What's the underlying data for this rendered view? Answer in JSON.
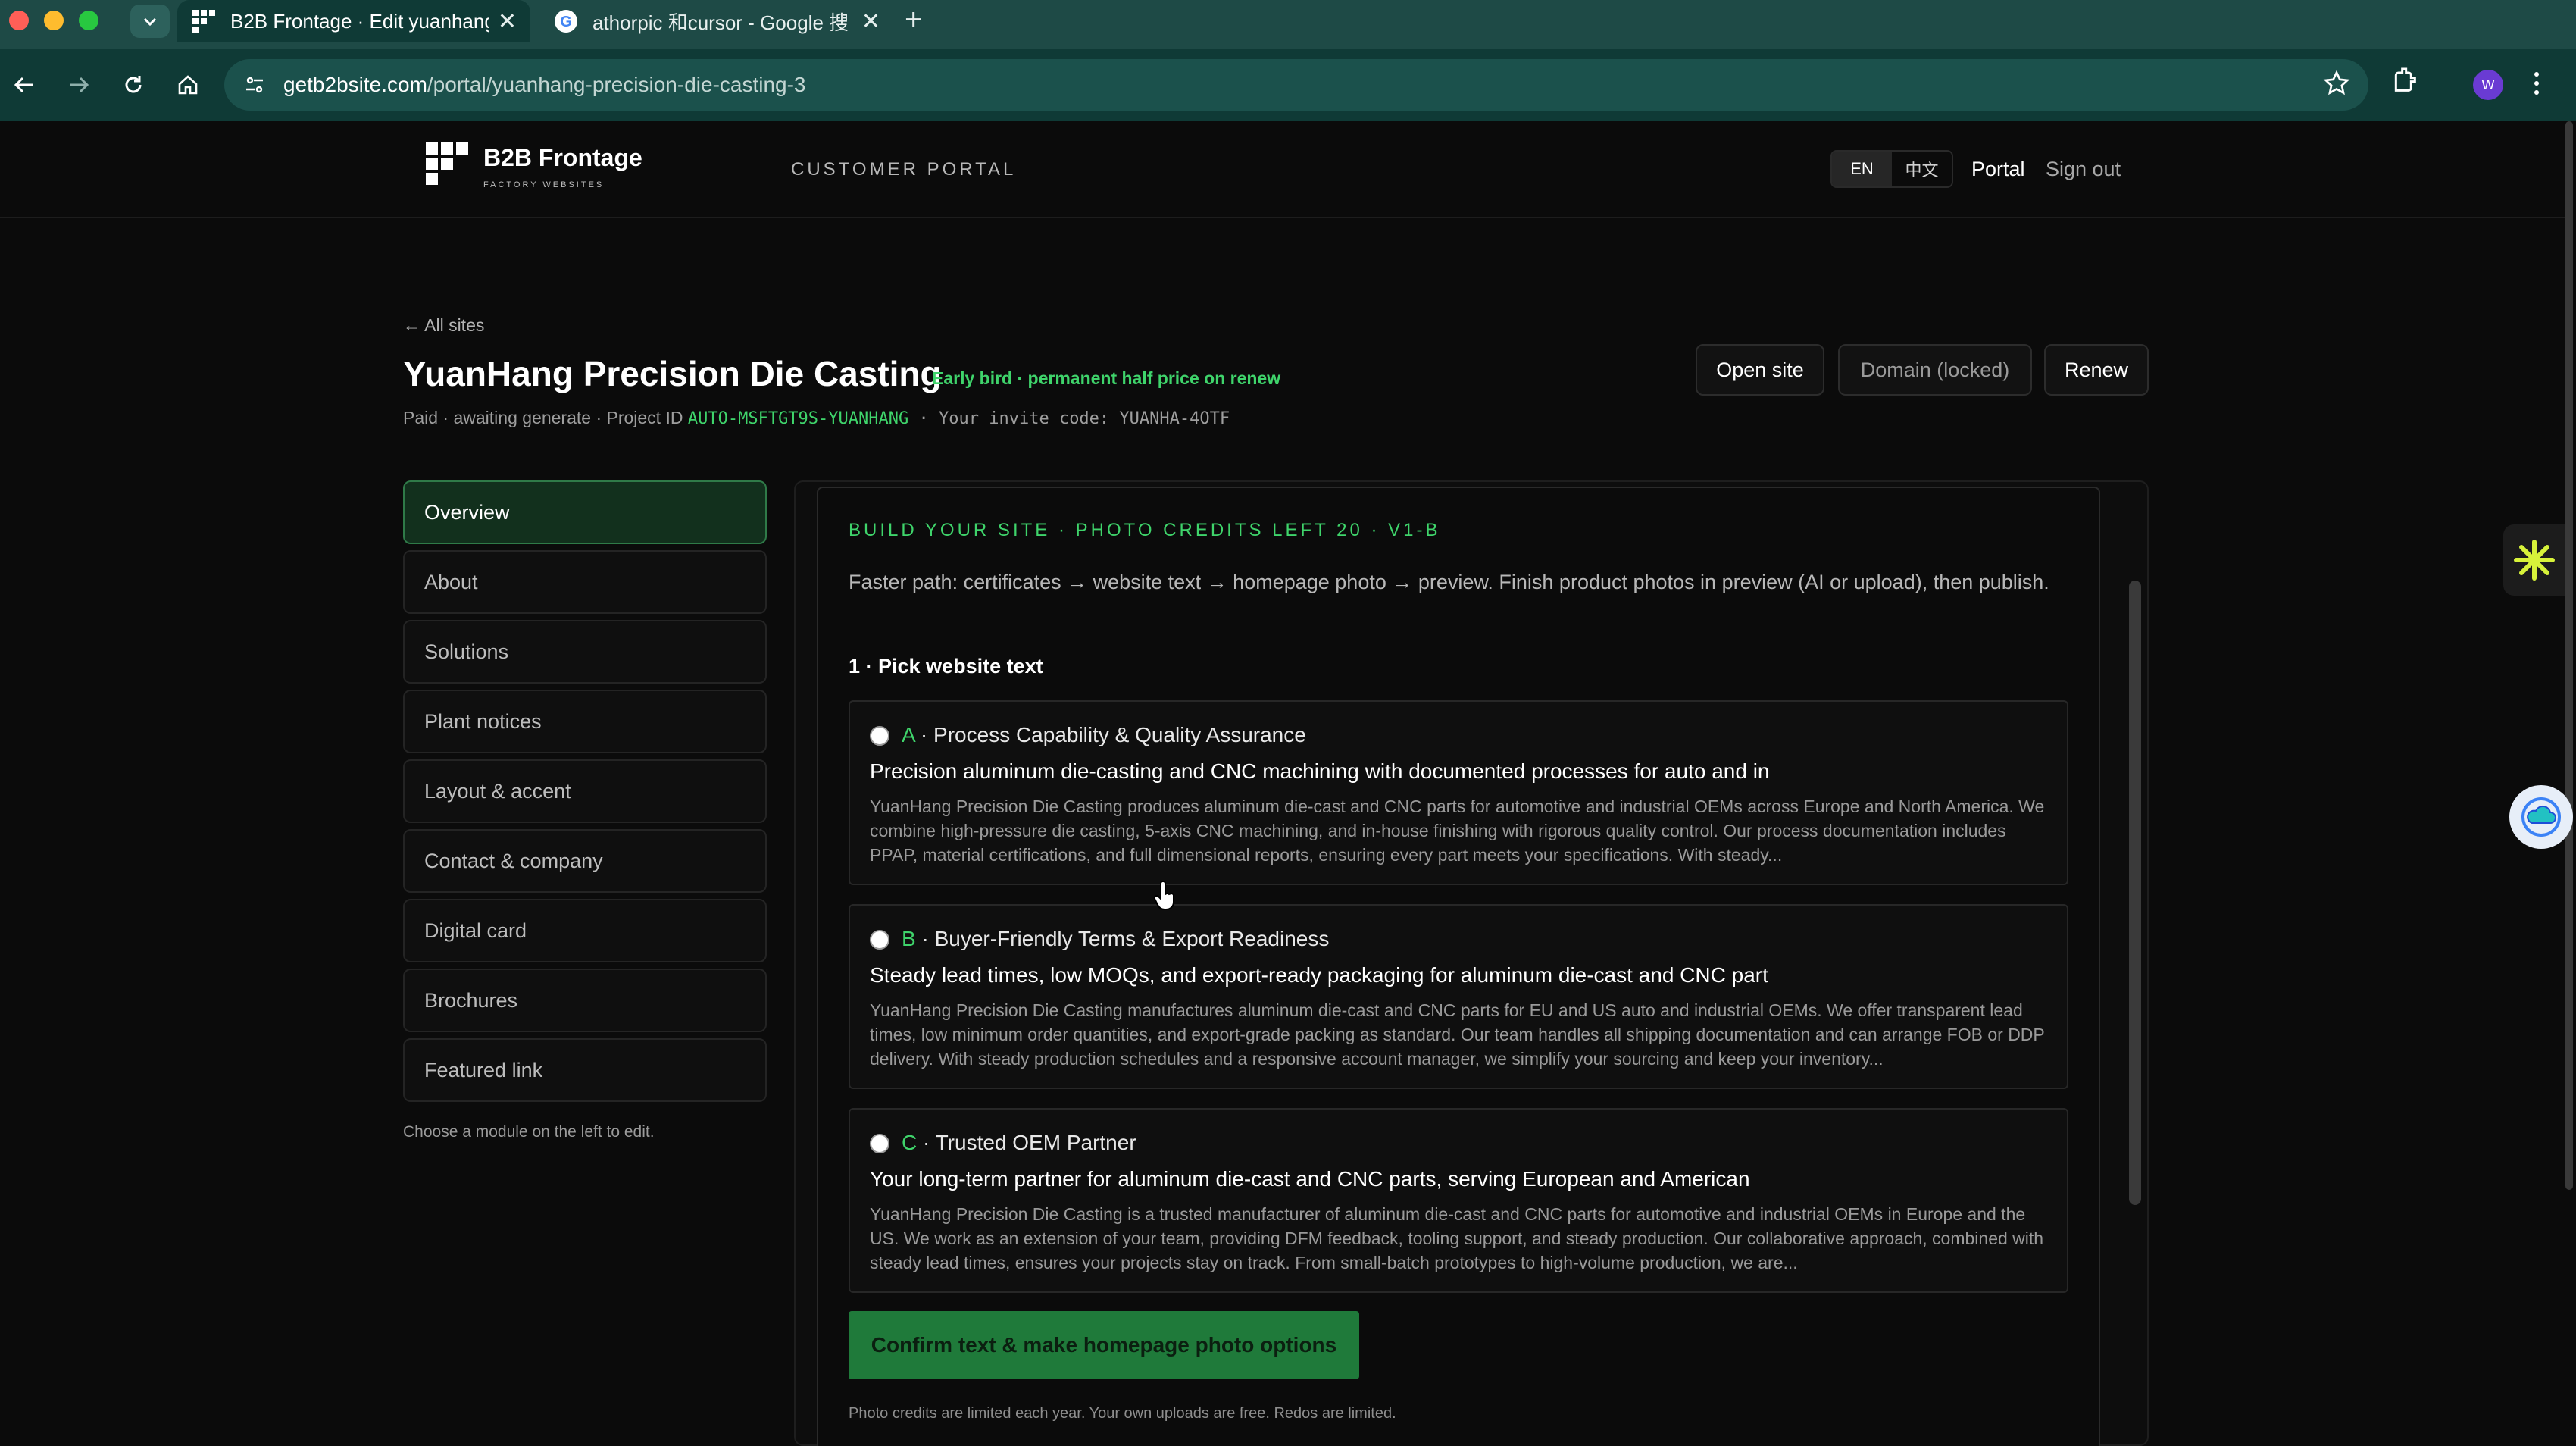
{
  "browser": {
    "tabs": [
      {
        "title": "B2B Frontage · Edit yuanhang"
      },
      {
        "title": "athorpic 和cursor - Google 搜"
      }
    ],
    "url_host": "getb2bsite.com",
    "url_path": "/portal/yuanhang-precision-die-casting-3",
    "profile_initial": "W"
  },
  "header": {
    "brand": "B2B Frontage",
    "brand_sub": "FACTORY WEBSITES",
    "portal_label": "CUSTOMER PORTAL",
    "lang_en": "EN",
    "lang_zh": "中文",
    "nav_portal": "Portal",
    "nav_signout": "Sign out"
  },
  "site": {
    "back": "← All sites",
    "title": "YuanHang Precision Die Casting",
    "early_bird": "Early bird · permanent half price on renew",
    "status": "Paid · awaiting generate · Project ID ",
    "project_id": "AUTO-MSFTGT9S-YUANHANG",
    "invite_label": " · Your invite code: ",
    "invite_code": "YUANHA-4OTF",
    "actions": {
      "open": "Open site",
      "domain": "Domain (locked)",
      "renew": "Renew"
    }
  },
  "sidebar": {
    "items": [
      {
        "label": "Overview"
      },
      {
        "label": "About"
      },
      {
        "label": "Solutions"
      },
      {
        "label": "Plant notices"
      },
      {
        "label": "Layout & accent"
      },
      {
        "label": "Contact & company"
      },
      {
        "label": "Digital card"
      },
      {
        "label": "Brochures"
      },
      {
        "label": "Featured link"
      }
    ],
    "hint": "Choose a module on the left to edit."
  },
  "builder": {
    "title": "BUILD YOUR SITE · PHOTO CREDITS LEFT 20 · V1-B",
    "description": "Faster path: certificates → website text → homepage photo → preview. Finish product photos in preview (AI or upload), then publish.",
    "step": "1 · Pick website text",
    "options": [
      {
        "letter": "A",
        "heading": " · Process Capability & Quality Assurance",
        "tagline": "Precision aluminum die-casting and CNC machining with documented processes for auto and in",
        "body": "YuanHang Precision Die Casting produces aluminum die-cast and CNC parts for automotive and industrial OEMs across Europe and North America. We combine high-pressure die casting, 5-axis CNC machining, and in-house finishing with rigorous quality control. Our process documentation includes PPAP, material certifications, and full dimensional reports, ensuring every part meets your specifications. With steady..."
      },
      {
        "letter": "B",
        "heading": " · Buyer-Friendly Terms & Export Readiness",
        "tagline": "Steady lead times, low MOQs, and export-ready packaging for aluminum die-cast and CNC part",
        "body": "YuanHang Precision Die Casting manufactures aluminum die-cast and CNC parts for EU and US auto and industrial OEMs. We offer transparent lead times, low minimum order quantities, and export-grade packing as standard. Our team handles all shipping documentation and can arrange FOB or DDP delivery. With steady production schedules and a responsive account manager, we simplify your sourcing and keep your inventory..."
      },
      {
        "letter": "C",
        "heading": " · Trusted OEM Partner",
        "tagline": "Your long-term partner for aluminum die-cast and CNC parts, serving European and American",
        "body": "YuanHang Precision Die Casting is a trusted manufacturer of aluminum die-cast and CNC parts for automotive and industrial OEMs in Europe and the US. We work as an extension of your team, providing DFM feedback, tooling support, and steady production. Our collaborative approach, combined with steady lead times, ensures your projects stay on track. From small-batch prototypes to high-volume production, we are..."
      }
    ],
    "confirm": "Confirm text & make homepage photo options",
    "note": "Photo credits are limited each year. Your own uploads are free. Redos are limited."
  },
  "colors": {
    "accent": "#3fd46b",
    "button": "#1f7a3a",
    "chrome": "#0f3a36"
  }
}
